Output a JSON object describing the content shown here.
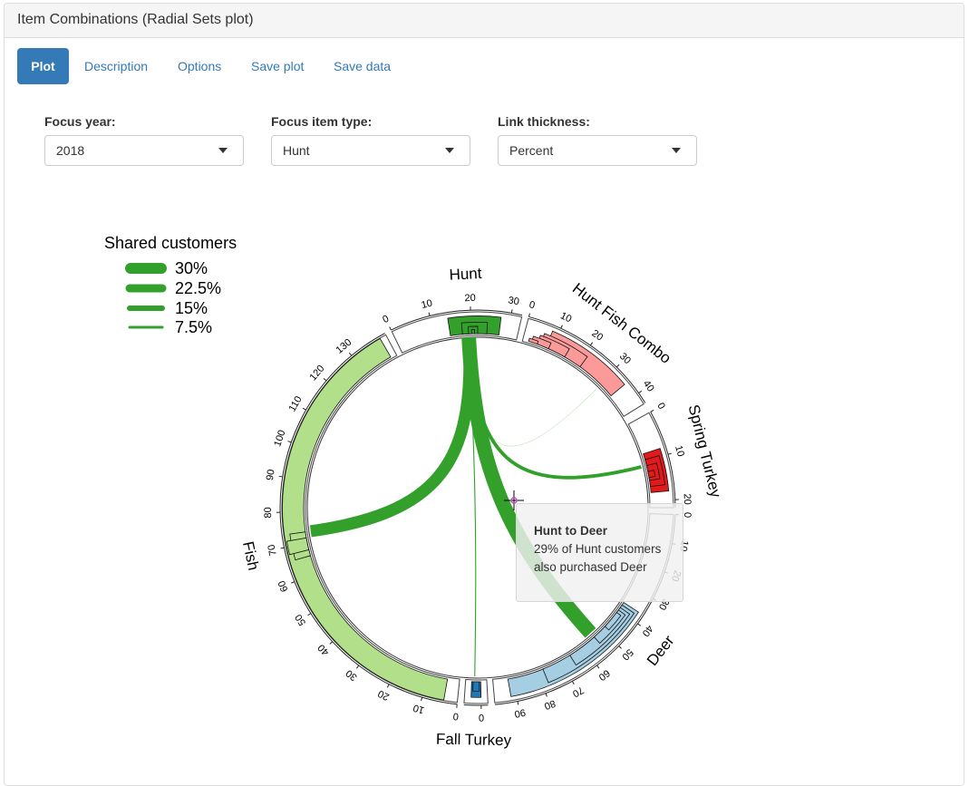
{
  "panel": {
    "title": "Item Combinations (Radial Sets plot)"
  },
  "tabs": [
    {
      "label": "Plot",
      "active": true
    },
    {
      "label": "Description",
      "active": false
    },
    {
      "label": "Options",
      "active": false
    },
    {
      "label": "Save plot",
      "active": false
    },
    {
      "label": "Save data",
      "active": false
    }
  ],
  "controls": {
    "focus_year": {
      "label": "Focus year:",
      "value": "2018"
    },
    "focus_item_type": {
      "label": "Focus item type:",
      "value": "Hunt"
    },
    "link_thickness": {
      "label": "Link thickness:",
      "value": "Percent"
    }
  },
  "chart_data": {
    "type": "radial_sets",
    "legend": {
      "title": "Shared customers",
      "entries": [
        {
          "label": "30%",
          "value": 30
        },
        {
          "label": "22.5%",
          "value": 22.5
        },
        {
          "label": "15%",
          "value": 15
        },
        {
          "label": "7.5%",
          "value": 7.5
        }
      ]
    },
    "focus": "Hunt",
    "sectors": [
      {
        "name": "Hunt",
        "color": "#33a02c",
        "axis_ticks": [
          "0",
          "10",
          "20",
          "30"
        ]
      },
      {
        "name": "Hunt Fish Combo",
        "color": "#fb9a99",
        "axis_ticks": [
          "0",
          "10",
          "20",
          "30",
          "40"
        ]
      },
      {
        "name": "Spring Turkey",
        "color": "#e31a1c",
        "axis_ticks": [
          "0",
          "10",
          "20"
        ]
      },
      {
        "name": "Deer",
        "color": "#a6cee3",
        "axis_ticks": [
          "0",
          "10",
          "20",
          "30",
          "40",
          "50",
          "60",
          "70",
          "80",
          "90"
        ]
      },
      {
        "name": "Fall Turkey",
        "color": "#1f78b4",
        "axis_ticks": [
          "0"
        ]
      },
      {
        "name": "Fish",
        "color": "#b2df8a",
        "axis_ticks": [
          "0",
          "10",
          "20",
          "30",
          "40",
          "50",
          "60",
          "70",
          "80",
          "90",
          "100",
          "110",
          "120",
          "130"
        ]
      }
    ],
    "links": [
      {
        "from": "Hunt",
        "to": "Deer",
        "percent": 29
      },
      {
        "from": "Hunt",
        "to": "Fish",
        "percent": 24
      },
      {
        "from": "Hunt",
        "to": "Spring Turkey",
        "percent": 7
      },
      {
        "from": "Hunt",
        "to": "Fall Turkey",
        "percent": 2
      },
      {
        "from": "Hunt",
        "to": "Hunt Fish Combo",
        "percent": 0.5
      }
    ],
    "colors": {
      "focus_link": "#33a02c",
      "ring": "#333333"
    }
  },
  "tooltip": {
    "title": "Hunt to Deer",
    "line1": "29% of Hunt customers",
    "line2": "also purchased Deer"
  }
}
